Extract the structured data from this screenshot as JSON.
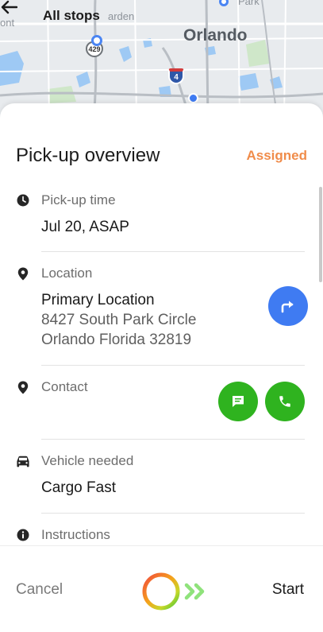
{
  "map": {
    "back_label": "All stops",
    "city_label": "Orlando",
    "place_label_left": "ont",
    "place_label_top": "arden",
    "place_label_right": "Park",
    "route_shield_1": "429",
    "route_shield_2": "4"
  },
  "overview": {
    "title": "Pick-up overview",
    "status": "Assigned",
    "status_color": "#f08c4a"
  },
  "pickup_time": {
    "label": "Pick-up time",
    "value": "Jul 20, ASAP",
    "icon": "clock-icon"
  },
  "location": {
    "label": "Location",
    "name": "Primary Location",
    "address_line1": "8427 South Park Circle",
    "address_line2": "Orlando Florida 32819",
    "icon": "location-pin-icon",
    "action_icon": "directions-icon"
  },
  "contact": {
    "label": "Contact",
    "icon": "location-pin-icon",
    "message_icon": "message-icon",
    "call_icon": "phone-icon"
  },
  "vehicle": {
    "label": "Vehicle needed",
    "value": "Cargo Fast",
    "icon": "car-icon"
  },
  "instructions": {
    "label": "Instructions",
    "icon": "info-icon"
  },
  "footer": {
    "cancel_label": "Cancel",
    "start_label": "Start"
  },
  "colors": {
    "accent_blue": "#3f7bf2",
    "accent_green": "#2fb31f",
    "status_orange": "#f08c4a"
  }
}
